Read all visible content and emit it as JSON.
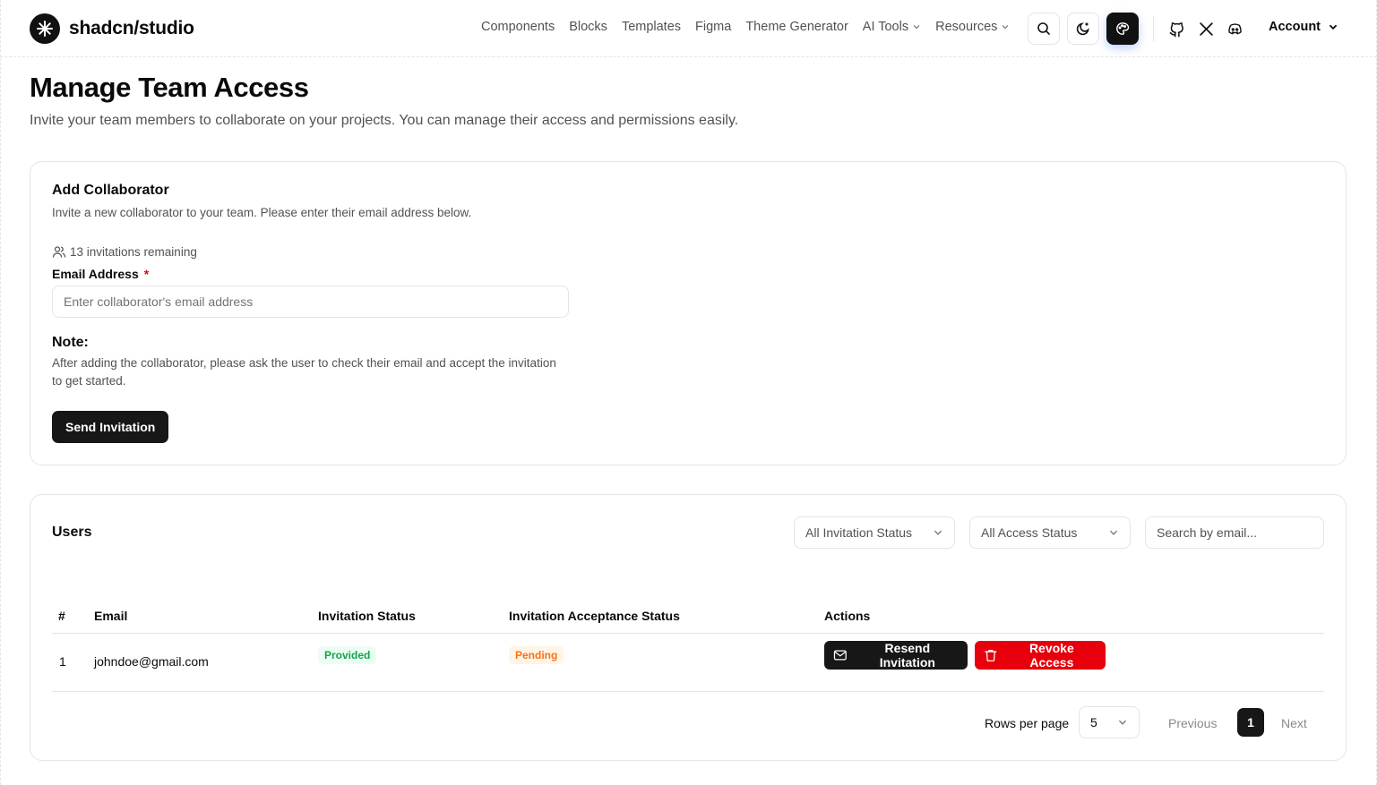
{
  "brand": {
    "name": "shadcn/studio"
  },
  "nav": {
    "items": [
      {
        "label": "Components"
      },
      {
        "label": "Blocks"
      },
      {
        "label": "Templates"
      },
      {
        "label": "Figma"
      },
      {
        "label": "Theme Generator"
      },
      {
        "label": "AI Tools",
        "has_dropdown": true
      },
      {
        "label": "Resources",
        "has_dropdown": true
      }
    ],
    "account_label": "Account",
    "icons": [
      "search-icon",
      "theme-toggle-icon",
      "palette-icon",
      "github-icon",
      "x-icon",
      "discord-icon"
    ]
  },
  "page": {
    "title": "Manage Team Access",
    "subtitle": "Invite your team members to collaborate on your projects. You can manage their access and permissions easily."
  },
  "add_collaborator": {
    "title": "Add Collaborator",
    "description": "Invite a new collaborator to your team. Please enter their email address below.",
    "invitations_remaining": "13 invitations remaining",
    "email_label": "Email Address",
    "required_mark": "*",
    "email_placeholder": "Enter collaborator's email address",
    "email_value": "",
    "note_title": "Note:",
    "note_text": "After adding the collaborator, please ask the user to check their email and accept the invitation to get started.",
    "send_button": "Send Invitation"
  },
  "users": {
    "title": "Users",
    "filters": {
      "invitation_status": "All Invitation Status",
      "access_status": "All Access Status",
      "search_placeholder": "Search by email..."
    },
    "columns": [
      "#",
      "Email",
      "Invitation Status",
      "Invitation Acceptance Status",
      "Actions"
    ],
    "rows": [
      {
        "index": "1",
        "email": "johndoe@gmail.com",
        "invitation_status": "Provided",
        "acceptance_status": "Pending",
        "resend_label": "Resend Invitation",
        "revoke_label": "Revoke Access"
      }
    ],
    "pagination": {
      "rows_per_page_label": "Rows per page",
      "rows_per_page_value": "5",
      "previous": "Previous",
      "current_page": "1",
      "next": "Next"
    }
  },
  "colors": {
    "primary": "#171717",
    "danger": "#e7000b",
    "success_text": "#16a34a",
    "success_bg": "#ecfdf3",
    "warning_text": "#f97316",
    "warning_bg": "#fff4e6",
    "muted_text": "#525252",
    "border": "#e5e5e5"
  }
}
